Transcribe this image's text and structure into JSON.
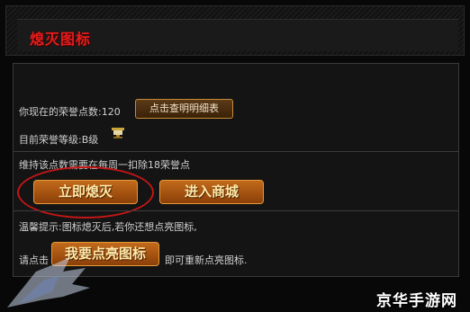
{
  "header": {
    "title": "熄灭图标"
  },
  "honor": {
    "points_text": "你现在的荣誉点数:120",
    "details_button": "点击查明明细表",
    "level_text": "目前荣誉等级:B级"
  },
  "maintain": {
    "notice": "维持该点数需要在每周一扣除18荣誉点",
    "extinguish_button": "立即熄灭",
    "shop_button": "进入商城"
  },
  "reminder": {
    "tip": "温馨提示:图标熄灭后,若你还想点亮图标,",
    "prefix": "请点击",
    "relight_button": "我要点亮图标",
    "suffix": "即可重新点亮图标."
  },
  "watermark": {
    "site": "京华手游网"
  },
  "colors": {
    "title": "#e11d1d",
    "button_gradient_top": "#c26a1c",
    "button_gradient_bottom": "#8a3f08",
    "highlight_ring": "#c31616"
  },
  "icons": {
    "level_badge": "trophy-icon",
    "watermark_logo": "winged-shield-logo"
  }
}
